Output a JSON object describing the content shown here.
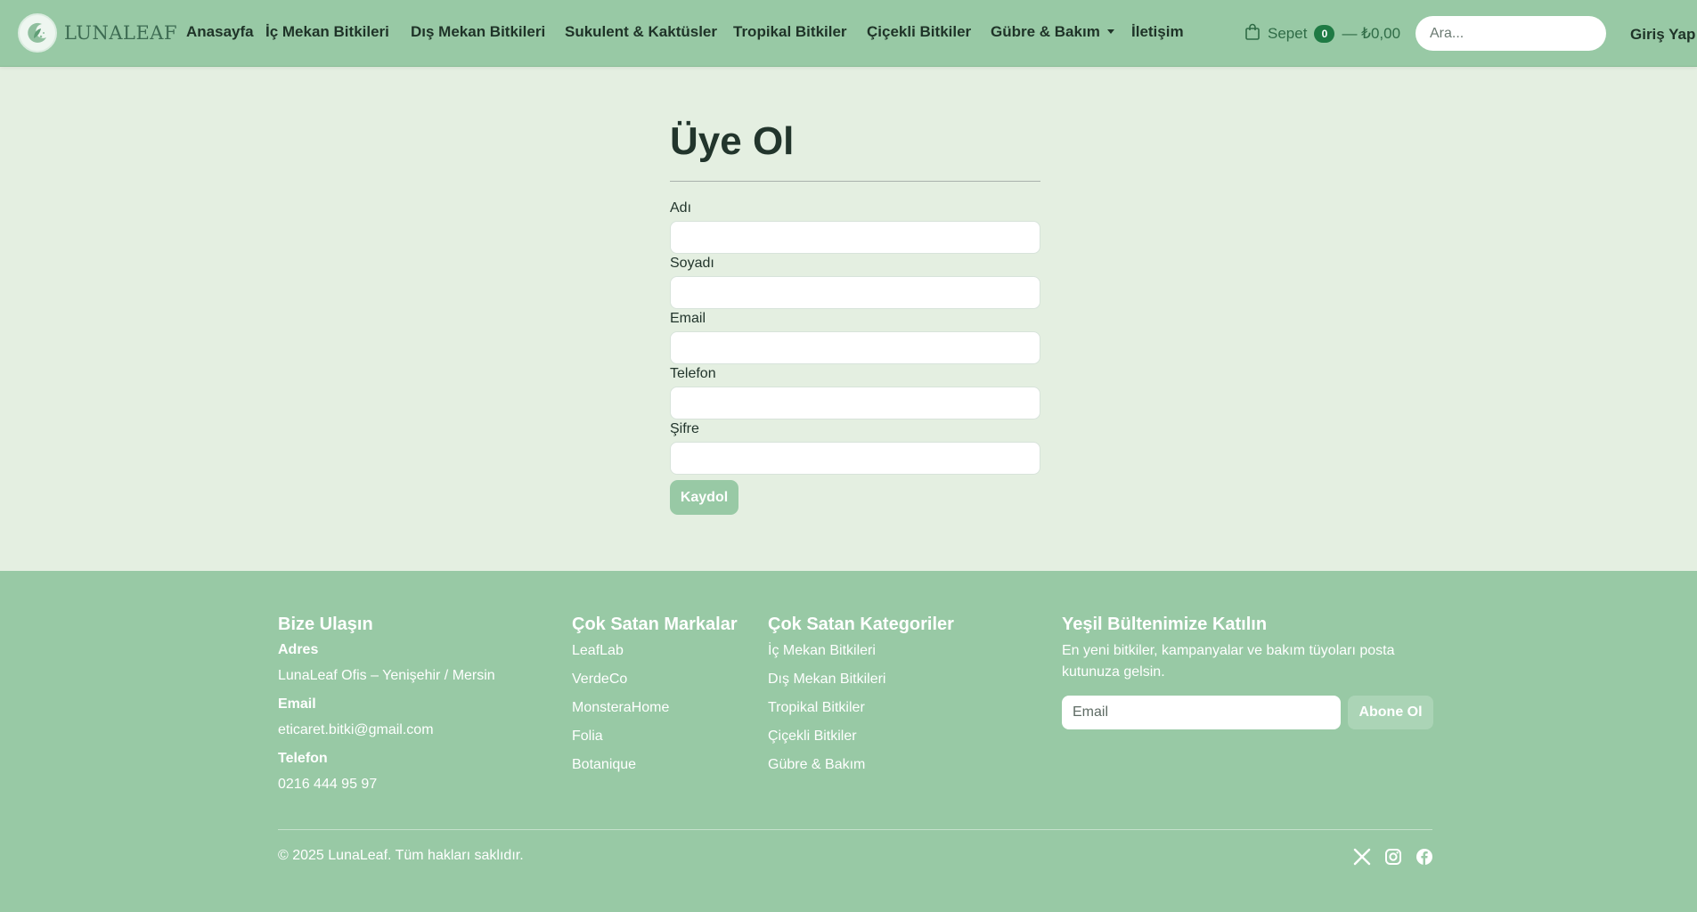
{
  "brand": {
    "name": "LUNALEAF"
  },
  "nav": {
    "items": [
      {
        "label": "Anasayfa"
      },
      {
        "label": "İç Mekan Bitkileri"
      },
      {
        "label": "Dış Mekan Bitkileri"
      },
      {
        "label": "Sukulent & Kaktüsler"
      },
      {
        "label": "Tropikal Bitkiler"
      },
      {
        "label": "Çiçekli Bitkiler"
      },
      {
        "label": "Gübre & Bakım"
      },
      {
        "label": "İletişim"
      }
    ]
  },
  "cart": {
    "label": "Sepet",
    "count": "0",
    "total": "— ₺0,00"
  },
  "search": {
    "placeholder": "Ara..."
  },
  "login": {
    "label": "Giriş Yap"
  },
  "form": {
    "title": "Üye Ol",
    "fields": [
      {
        "label": "Adı",
        "value": ""
      },
      {
        "label": "Soyadı",
        "value": ""
      },
      {
        "label": "Email",
        "value": ""
      },
      {
        "label": "Telefon",
        "value": ""
      },
      {
        "label": "Şifre",
        "value": ""
      }
    ],
    "submit": "Kaydol"
  },
  "footer": {
    "contact": {
      "title": "Bize Ulaşın",
      "address_label": "Adres",
      "address": "LunaLeaf Ofis – Yenişehir / Mersin",
      "email_label": "Email",
      "email": "eticaret.bitki@gmail.com",
      "phone_label": "Telefon",
      "phone": "0216 444 95 97"
    },
    "brands": {
      "title": "Çok Satan Markalar",
      "items": [
        "LeafLab",
        "VerdeCo",
        "MonsteraHome",
        "Folia",
        "Botanique"
      ]
    },
    "categories": {
      "title": "Çok Satan Kategoriler",
      "items": [
        "İç Mekan Bitkileri",
        "Dış Mekan Bitkileri",
        "Tropikal Bitkiler",
        "Çiçekli Bitkiler",
        "Gübre & Bakım"
      ]
    },
    "newsletter": {
      "title": "Yeşil Bültenimize Katılın",
      "text": "En yeni bitkiler, kampanyalar ve bakım tüyoları posta kutunuza gelsin.",
      "placeholder": "Email",
      "button": "Abone Ol"
    },
    "copyright": "© 2025 LunaLeaf. Tüm hakları saklıdır.",
    "socials": [
      "x-icon",
      "instagram-icon",
      "facebook-icon"
    ]
  },
  "colors": {
    "header_bg": "#98c9a5",
    "page_bg": "#e4efe1",
    "footer_bg": "#98c9a5",
    "badge": "#1f7a44",
    "button": "#98c9a5"
  }
}
